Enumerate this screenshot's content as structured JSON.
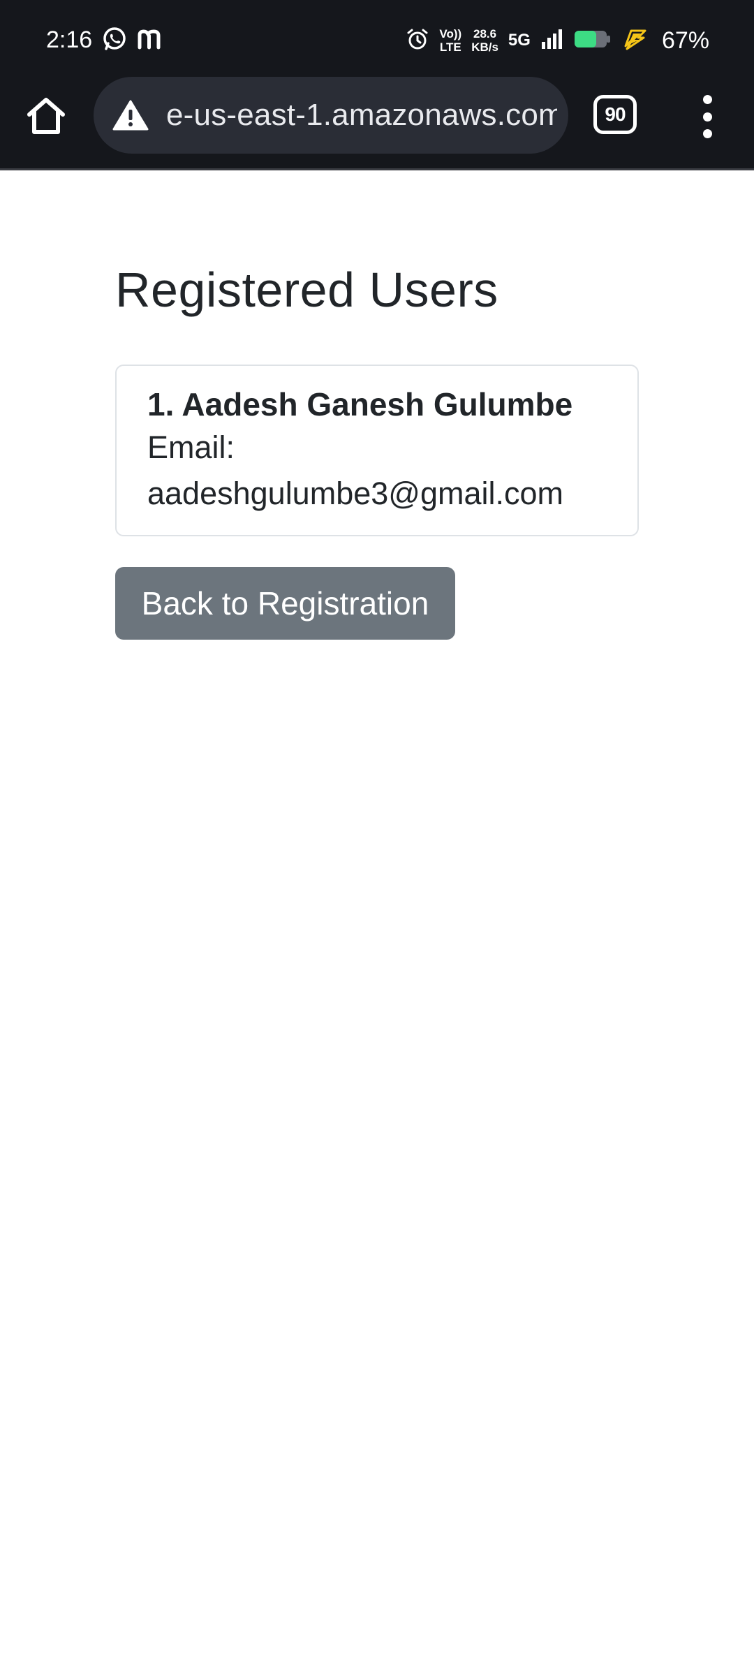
{
  "status_bar": {
    "time": "2:16",
    "net_speed_value": "28.6",
    "net_speed_unit": "KB/s",
    "network_type": "5G",
    "volte_line1": "Vo))",
    "volte_line2": "LTE",
    "battery_percent": "67%",
    "app_icons": [
      "whatsapp-icon",
      "m-app-icon"
    ],
    "colors": {
      "battery_fill": "#3ddc84",
      "charging_bolt": "#f5c518"
    }
  },
  "browser": {
    "url": "e-us-east-1.amazonaws.com",
    "tab_count": "90",
    "icons": {
      "home": "home-icon",
      "warning": "warning-icon",
      "menu": "more-vert-icon"
    }
  },
  "page": {
    "title": "Registered Users",
    "users": [
      {
        "name": "1. Aadesh Ganesh Gulumbe",
        "email_label": "Email:",
        "email": "aadeshgulumbe3@gmail.com"
      }
    ],
    "back_button_label": "Back to Registration",
    "colors": {
      "text": "#212529",
      "button_bg": "#6c757d",
      "card_border": "#dee2e6"
    }
  }
}
